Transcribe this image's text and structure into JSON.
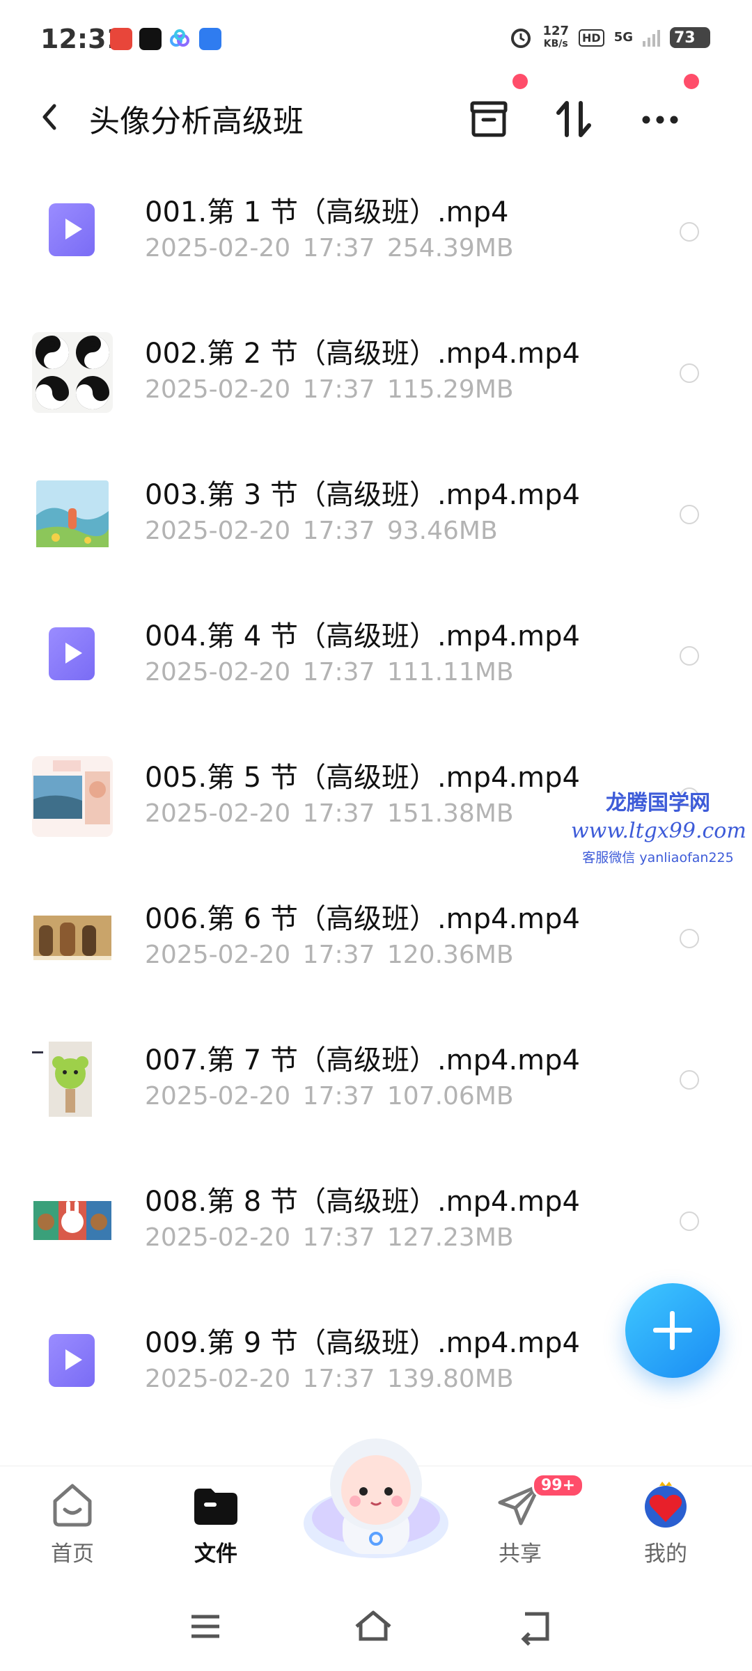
{
  "status_bar": {
    "time": "12:31",
    "net_speed_value": "127",
    "net_speed_unit": "KB/s",
    "hd": "HD",
    "network": "5G",
    "battery": "73"
  },
  "header": {
    "title": "头像分析高级班",
    "icons": [
      "back-icon",
      "archive-icon",
      "sort-icon",
      "more-icon"
    ]
  },
  "files": [
    {
      "name": "001.第 1 节（高级班）.mp4",
      "date": "2025-02-20",
      "time": "17:37",
      "size": "254.39MB",
      "thumb": "video-icon"
    },
    {
      "name": "002.第 2 节（高级班）.mp4.mp4",
      "date": "2025-02-20",
      "time": "17:37",
      "size": "115.29MB",
      "thumb": "yin-yang-thumbnail"
    },
    {
      "name": "003.第 3 节（高级班）.mp4.mp4",
      "date": "2025-02-20",
      "time": "17:37",
      "size": "93.46MB",
      "thumb": "landscape-thumbnail"
    },
    {
      "name": "004.第 4 节（高级班）.mp4.mp4",
      "date": "2025-02-20",
      "time": "17:37",
      "size": "111.11MB",
      "thumb": "video-icon"
    },
    {
      "name": "005.第 5 节（高级班）.mp4.mp4",
      "date": "2025-02-20",
      "time": "17:37",
      "size": "151.38MB",
      "thumb": "collage-thumbnail"
    },
    {
      "name": "006.第 6 节（高级班）.mp4.mp4",
      "date": "2025-02-20",
      "time": "17:37",
      "size": "120.36MB",
      "thumb": "figurines-thumbnail"
    },
    {
      "name": "007.第 7 节（高级班）.mp4.mp4",
      "date": "2025-02-20",
      "time": "17:37",
      "size": "107.06MB",
      "thumb": "plush-thumbnail"
    },
    {
      "name": "008.第 8 节（高级班）.mp4.mp4",
      "date": "2025-02-20",
      "time": "17:37",
      "size": "127.23MB",
      "thumb": "cartoon-thumbnail"
    },
    {
      "name": "009.第 9 节（高级班）.mp4.mp4",
      "date": "2025-02-20",
      "time": "17:37",
      "size": "139.80MB",
      "thumb": "video-icon"
    }
  ],
  "watermark": {
    "line1": "龙腾国学网",
    "line2": "www.ltgx99.com",
    "line3": "客服微信 yanliaofan225"
  },
  "bottom_nav": {
    "home": "首页",
    "files": "文件",
    "share": "共享",
    "share_badge": "99+",
    "mine": "我的"
  },
  "colors": {
    "accent": "#1a8cf4",
    "badge": "#ff4d6a",
    "video_icon": "#8a7cf8",
    "meta_text": "#b3b3b3"
  }
}
